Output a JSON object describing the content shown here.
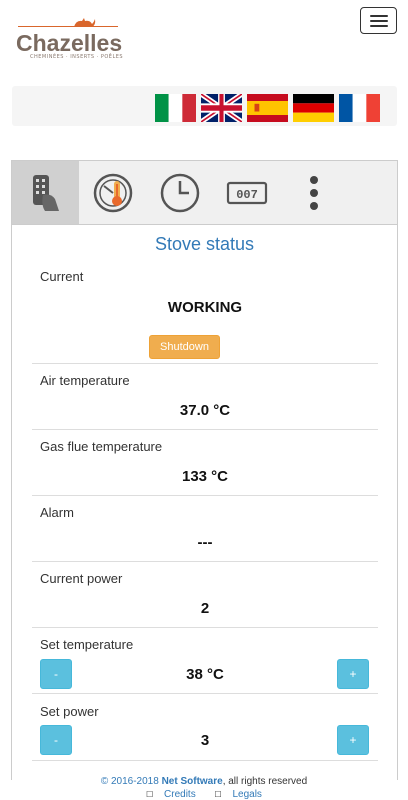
{
  "brand": {
    "name": "Chazelles",
    "tagline": "CHEMINÉES · INSERTS · POÊLES",
    "accent": "#d9662c"
  },
  "navbar": {
    "menu_icon": "hamburger-icon"
  },
  "languages": [
    "Italiano",
    "English",
    "Español",
    "Deutsch",
    "Français"
  ],
  "tabs": [
    {
      "icon": "remote-control-icon",
      "active": true
    },
    {
      "icon": "thermometer-dial-icon",
      "active": false
    },
    {
      "icon": "clock-icon",
      "active": false
    },
    {
      "icon": "display-counter-icon",
      "active": false
    },
    {
      "icon": "more-vertical-icon",
      "active": false
    }
  ],
  "status": {
    "title": "Stove status",
    "current": {
      "label": "Current",
      "value": "WORKING",
      "button": "Shutdown"
    },
    "air_temperature": {
      "label": "Air temperature",
      "value": "37.0 °C"
    },
    "gas_flue_temperature": {
      "label": "Gas flue temperature",
      "value": "133 °C"
    },
    "alarm": {
      "label": "Alarm",
      "value": "---"
    },
    "current_power": {
      "label": "Current power",
      "value": "2"
    },
    "set_temperature": {
      "label": "Set temperature",
      "value": "38 °C",
      "minus": "-",
      "plus": "+"
    },
    "set_power": {
      "label": "Set power",
      "value": "3",
      "minus": "-",
      "plus": "+"
    }
  },
  "footer": {
    "copyright_prefix": "© 2016-2018",
    "company": "Net Software",
    "copyright_suffix": ", all rights reserved",
    "credits": "Credits",
    "legals": "Legals"
  },
  "colors": {
    "primary": "#337ab7",
    "warning": "#f0ad4e",
    "info": "#5bc0de"
  }
}
